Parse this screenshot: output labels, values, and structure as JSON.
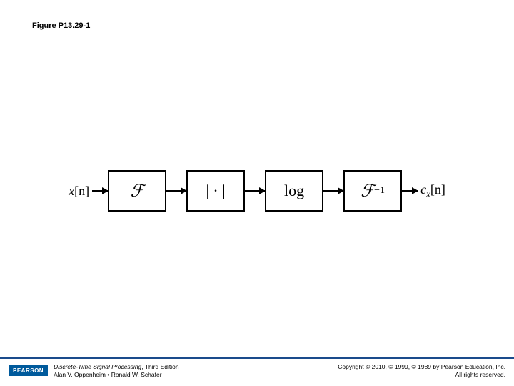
{
  "figure_title": "Figure P13.29-1",
  "input_label_var": "x",
  "input_label_idx": "[n]",
  "output_label_var": "c",
  "output_label_sub": "x",
  "output_label_idx": "[n]",
  "blocks": {
    "fourier": "ℱ",
    "magnitude": "| · |",
    "log": "log",
    "inverse_fourier_base": "ℱ",
    "inverse_fourier_exp": "−1"
  },
  "footer": {
    "logo": "PEARSON",
    "book_title": "Discrete-Time Signal Processing",
    "book_edition": ", Third Edition",
    "authors": "Alan V. Oppenheim • Ronald W. Schafer",
    "copyright": "Copyright © 2010, © 1999, © 1989 by Pearson Education, Inc.",
    "rights": "All rights reserved."
  }
}
